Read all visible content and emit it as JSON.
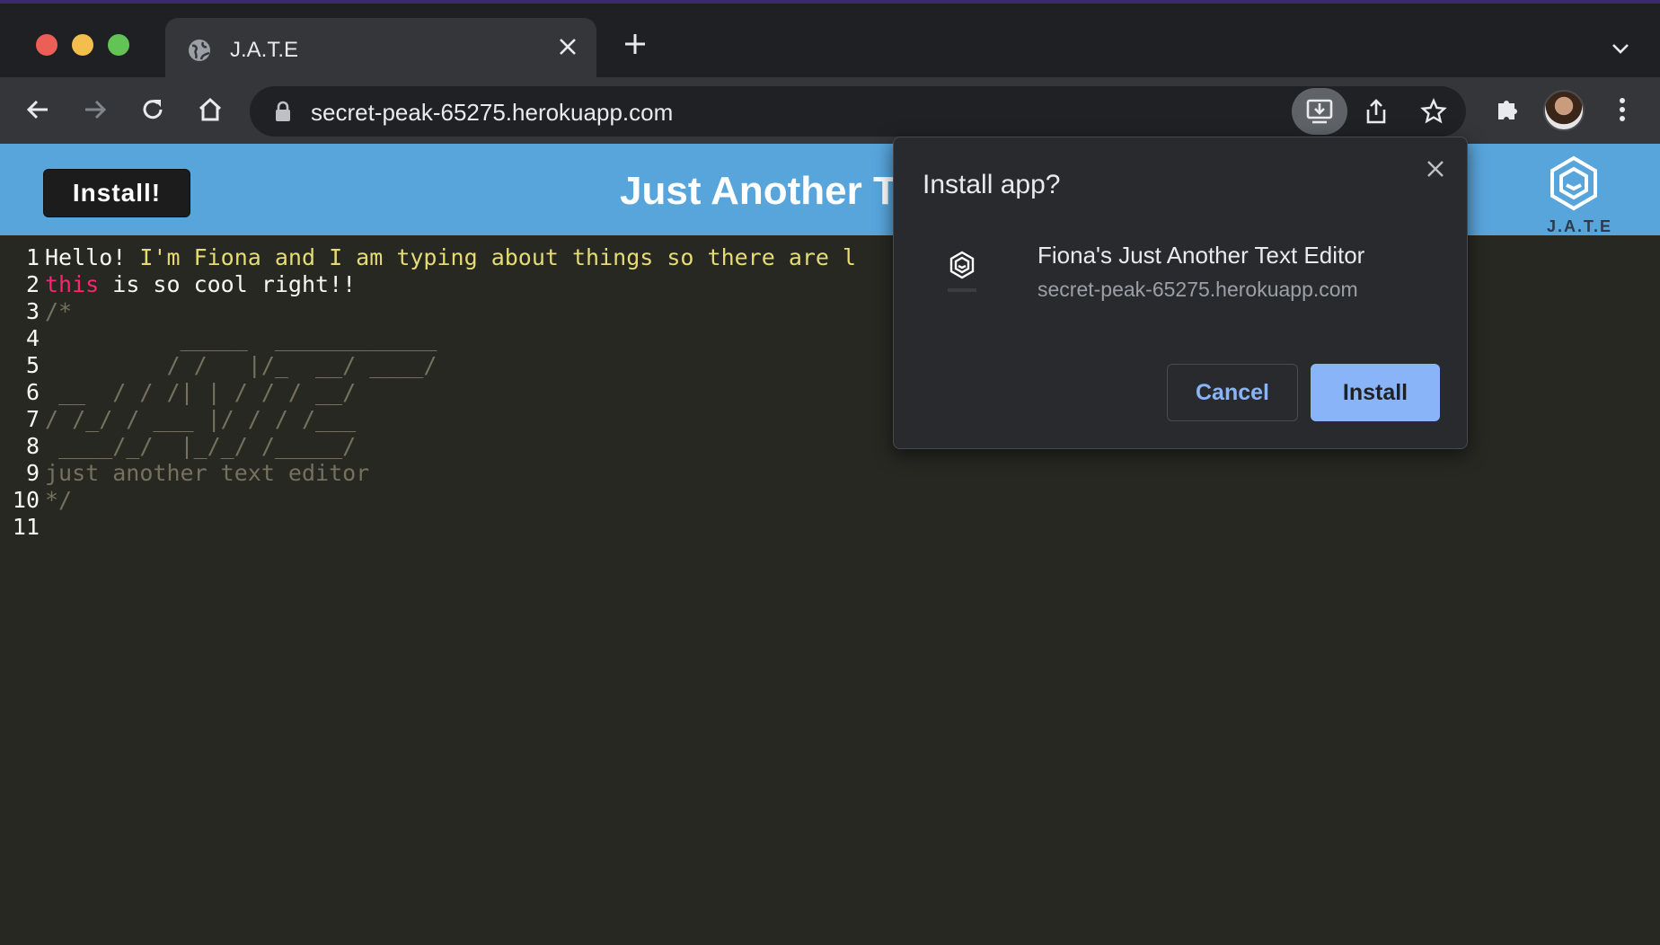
{
  "browser": {
    "tab_title": "J.A.T.E",
    "url": "secret-peak-65275.herokuapp.com"
  },
  "app": {
    "install_label": "Install!",
    "title": "Just Another Text Editor",
    "logo_text": "J.A.T.E",
    "header_color": "#58a5dc"
  },
  "editor": {
    "lines": [
      {
        "num": "1",
        "segments": [
          {
            "text": "Hello! ",
            "cls": "c-white"
          },
          {
            "text": "I'm Fiona and I am typing about things so there are l",
            "cls": "c-yellow"
          }
        ]
      },
      {
        "num": "2",
        "segments": [
          {
            "text": "this",
            "cls": "c-pink"
          },
          {
            "text": " is so cool right!!",
            "cls": "c-white"
          }
        ]
      },
      {
        "num": "3",
        "segments": [
          {
            "text": "/*",
            "cls": "c-comment"
          }
        ]
      },
      {
        "num": "4",
        "segments": [
          {
            "text": "          _____  ____________",
            "cls": "c-comment"
          }
        ]
      },
      {
        "num": "5",
        "segments": [
          {
            "text": "         / /   |/_  __/ ____/",
            "cls": "c-comment"
          }
        ]
      },
      {
        "num": "6",
        "segments": [
          {
            "text": " __  / / /| | / / / __/",
            "cls": "c-comment"
          }
        ]
      },
      {
        "num": "7",
        "segments": [
          {
            "text": "/ /_/ / ___ |/ / / /___",
            "cls": "c-comment"
          }
        ]
      },
      {
        "num": "8",
        "segments": [
          {
            "text": " ____/_/  |_/_/ /_____/",
            "cls": "c-comment"
          }
        ]
      },
      {
        "num": "9",
        "segments": [
          {
            "text": "just another text editor",
            "cls": "c-comment"
          }
        ]
      },
      {
        "num": "10",
        "segments": [
          {
            "text": "*/",
            "cls": "c-comment"
          }
        ]
      },
      {
        "num": "11",
        "segments": []
      }
    ]
  },
  "popup": {
    "title": "Install app?",
    "app_name": "Fiona's Just Another Text Editor",
    "app_url": "secret-peak-65275.herokuapp.com",
    "cancel_label": "Cancel",
    "install_label": "Install"
  },
  "icons": [
    "globe-icon",
    "close-icon",
    "plus-icon",
    "chevron-down-icon",
    "back-arrow-icon",
    "forward-arrow-icon",
    "reload-icon",
    "home-icon",
    "lock-icon",
    "install-app-icon",
    "share-icon",
    "star-icon",
    "extensions-icon",
    "more-vert-icon"
  ]
}
